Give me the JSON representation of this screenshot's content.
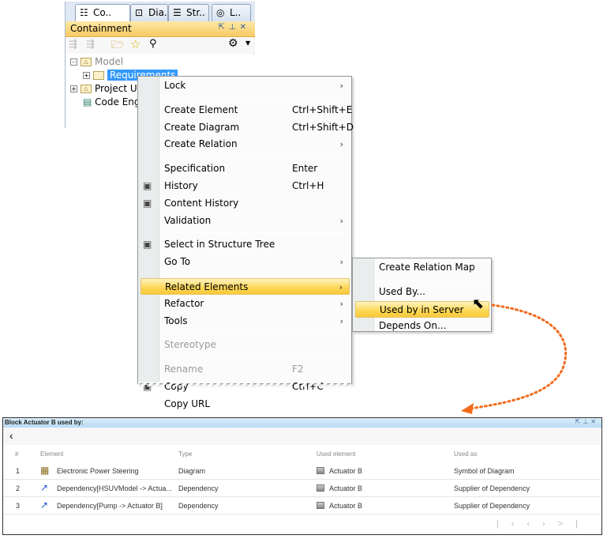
{
  "browser": {
    "tabs": [
      {
        "label": "Co..",
        "icon": "containment-icon"
      },
      {
        "label": "Dia..",
        "icon": "diagrams-icon"
      },
      {
        "label": "Str..",
        "icon": "structure-icon"
      },
      {
        "label": "L..",
        "icon": "lock-view-icon"
      }
    ],
    "panel_title": "Containment",
    "tree": [
      {
        "label": "Model"
      },
      {
        "label": "Requirements"
      },
      {
        "label": "Project Us"
      },
      {
        "label": "Code Eng"
      }
    ]
  },
  "menu": {
    "items": [
      {
        "label": "Lock",
        "arrow": true
      },
      {
        "sep": true
      },
      {
        "label": "Create Element",
        "shortcut": "Ctrl+Shift+E"
      },
      {
        "label": "Create Diagram",
        "shortcut": "Ctrl+Shift+D"
      },
      {
        "label": "Create Relation",
        "arrow": true
      },
      {
        "sep": true
      },
      {
        "label": "Specification",
        "shortcut": "Enter"
      },
      {
        "label": "History",
        "shortcut": "Ctrl+H",
        "icon": "history-icon"
      },
      {
        "label": "Content History",
        "icon": "content-history-icon"
      },
      {
        "label": "Validation",
        "arrow": true
      },
      {
        "sep": true
      },
      {
        "label": "Select in Structure Tree",
        "icon": "structure-tree-icon"
      },
      {
        "label": "Go To",
        "arrow": true
      },
      {
        "sep": true
      },
      {
        "label": "Related Elements",
        "arrow": true,
        "highlight": true
      },
      {
        "label": "Refactor",
        "arrow": true
      },
      {
        "label": "Tools",
        "arrow": true
      },
      {
        "sep": true
      },
      {
        "label": "Stereotype",
        "disabled": true
      },
      {
        "sep": true
      },
      {
        "label": "Rename",
        "shortcut": "F2",
        "disabled": true
      },
      {
        "label": "Copy",
        "shortcut": "Ctrl+C",
        "icon": "copy-icon"
      },
      {
        "label": "Copy URL"
      }
    ]
  },
  "submenu": {
    "items": [
      {
        "label": "Create Relation Map"
      },
      {
        "sep": true
      },
      {
        "label": "Used By..."
      },
      {
        "label": "Used by in Server",
        "highlight": true
      },
      {
        "label": "Depends On..."
      }
    ]
  },
  "usage": {
    "title": "Block Actuator B used by:",
    "columns": [
      "#",
      "Element",
      "Type",
      "Used element",
      "Used as"
    ],
    "rows": [
      {
        "n": "1",
        "element": "Electronic Power Steering",
        "type": "Diagram",
        "used": "Actuator B",
        "as": "Symbol of Diagram",
        "icon": "diagram-icon"
      },
      {
        "n": "2",
        "element": "Dependency[HSUVModel -> Actua...",
        "type": "Dependency",
        "used": "Actuator B",
        "as": "Supplier of Dependency",
        "icon": "dependency-icon"
      },
      {
        "n": "3",
        "element": "Dependency[Pump -> Actuator B]",
        "type": "Dependency",
        "used": "Actuator B",
        "as": "Supplier of Dependency",
        "icon": "dependency-icon"
      }
    ]
  },
  "colors": {
    "highlight": "#fcd653",
    "arrow": "#f26b1d",
    "selection": "#3399ff"
  }
}
